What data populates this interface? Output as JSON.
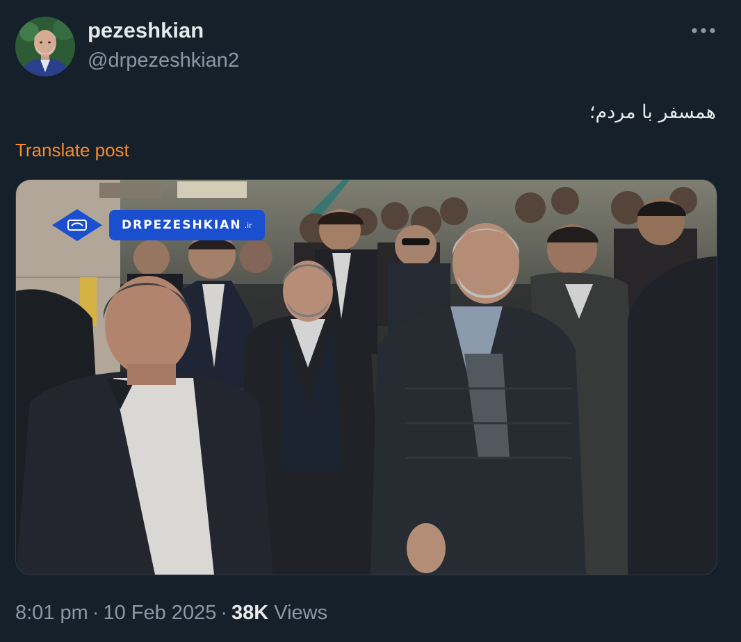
{
  "author": {
    "display_name": "pezeshkian",
    "handle": "@drpezeshkian2",
    "avatar_icon": "profile-photo"
  },
  "post": {
    "text": "همسفر با مردم؛",
    "translate_label": "Translate post"
  },
  "media": {
    "watermark_text": "DRPEZESHKIAN",
    "watermark_tld": ".ir"
  },
  "meta": {
    "time": "8:01 pm",
    "date": "10 Feb 2025",
    "separator": "·",
    "views_count": "38K",
    "views_label": "Views"
  },
  "colors": {
    "background": "#15202b",
    "translate_link": "#f98a2d",
    "secondary_text": "#8b98a5",
    "watermark_blue": "#1a4fd0"
  }
}
